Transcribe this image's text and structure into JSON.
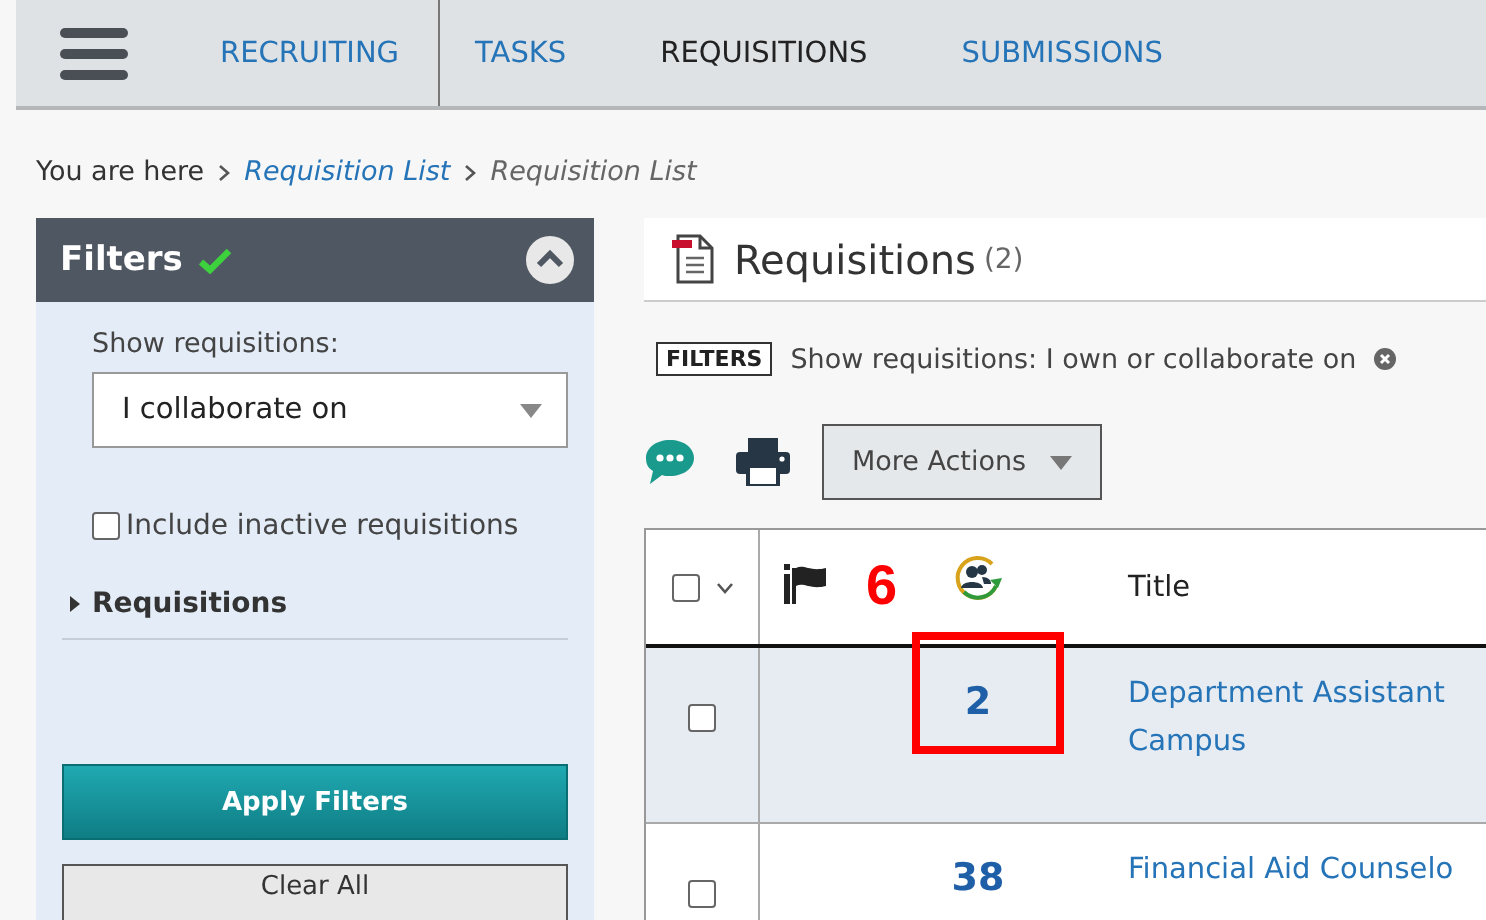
{
  "nav": {
    "tabs": [
      {
        "label": "RECRUITING",
        "selected": false
      },
      {
        "label": "TASKS",
        "selected": false
      },
      {
        "label": "REQUISITIONS",
        "selected": true
      },
      {
        "label": "SUBMISSIONS",
        "selected": false
      }
    ]
  },
  "breadcrumb": {
    "prefix": "You are here",
    "items": [
      {
        "label": "Requisition List",
        "link": true
      },
      {
        "label": "Requisition List",
        "link": false
      }
    ]
  },
  "filters": {
    "title": "Filters",
    "applied": true,
    "show_label": "Show requisitions:",
    "show_value": "I collaborate on",
    "include_inactive": {
      "label": "Include inactive requisitions",
      "checked": false
    },
    "section": {
      "label": "Requisitions",
      "expanded": false
    },
    "apply_button": "Apply Filters",
    "clear_button": "Clear All"
  },
  "main": {
    "title": "Requisitions",
    "count": "(2)",
    "filter_tag": "FILTERS",
    "filter_text": "Show requisitions: I own or collaborate on",
    "more_actions": "More Actions"
  },
  "table": {
    "header_checked": false,
    "title_column": "Title",
    "rows": [
      {
        "checked": false,
        "selected": true,
        "count": "2",
        "title_lines": [
          "Department Assistant",
          "Campus"
        ]
      },
      {
        "checked": false,
        "selected": false,
        "count": "38",
        "title_lines": [
          "Financial Aid Counselo"
        ]
      }
    ]
  },
  "annotation": {
    "label": "6"
  }
}
